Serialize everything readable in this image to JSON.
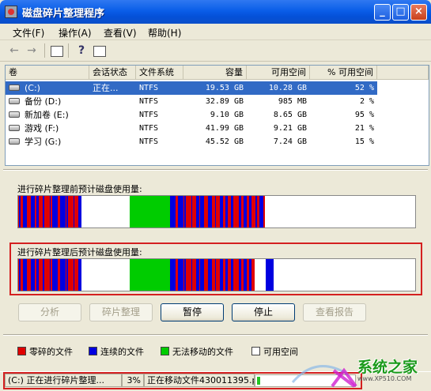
{
  "window": {
    "title": "磁盘碎片整理程序"
  },
  "menu": [
    "文件(F)",
    "操作(A)",
    "查看(V)",
    "帮助(H)"
  ],
  "columns": [
    "卷",
    "会话状态",
    "文件系统",
    "容量",
    "可用空间",
    "% 可用空间"
  ],
  "volumes": [
    {
      "name": "(C:)",
      "status": "正在...",
      "fs": "NTFS",
      "capacity": "19.53 GB",
      "free": "10.28 GB",
      "pct": "52 %",
      "selected": true
    },
    {
      "name": "备份 (D:)",
      "status": "",
      "fs": "NTFS",
      "capacity": "32.89 GB",
      "free": "985 MB",
      "pct": "2 %",
      "selected": false
    },
    {
      "name": "新加卷 (E:)",
      "status": "",
      "fs": "NTFS",
      "capacity": "9.10 GB",
      "free": "8.65 GB",
      "pct": "95 %",
      "selected": false
    },
    {
      "name": "游戏 (F:)",
      "status": "",
      "fs": "NTFS",
      "capacity": "41.99 GB",
      "free": "9.21 GB",
      "pct": "21 %",
      "selected": false
    },
    {
      "name": "学习 (G:)",
      "status": "",
      "fs": "NTFS",
      "capacity": "45.52 GB",
      "free": "7.24 GB",
      "pct": "15 %",
      "selected": false
    }
  ],
  "analysis": {
    "before_label": "进行碎片整理前预计磁盘使用量:",
    "after_label": "进行碎片整理后预计磁盘使用量:"
  },
  "buttons": {
    "analyze": "分析",
    "defrag": "碎片整理",
    "pause": "暂停",
    "stop": "停止",
    "report": "查看报告"
  },
  "legend": [
    {
      "label": "零碎的文件",
      "color": "#e00000"
    },
    {
      "label": "连续的文件",
      "color": "#0000e0"
    },
    {
      "label": "无法移动的文件",
      "color": "#00cc00"
    },
    {
      "label": "可用空间",
      "color": "#ffffff"
    }
  ],
  "status": {
    "volume_state": "(C:) 正在进行碎片整理...",
    "percent": "3%",
    "moving": "正在移动文件430011395.p",
    "progress_fraction": 0.03
  },
  "watermark": {
    "text": "系统之家",
    "url": "www.XP510.COM"
  }
}
